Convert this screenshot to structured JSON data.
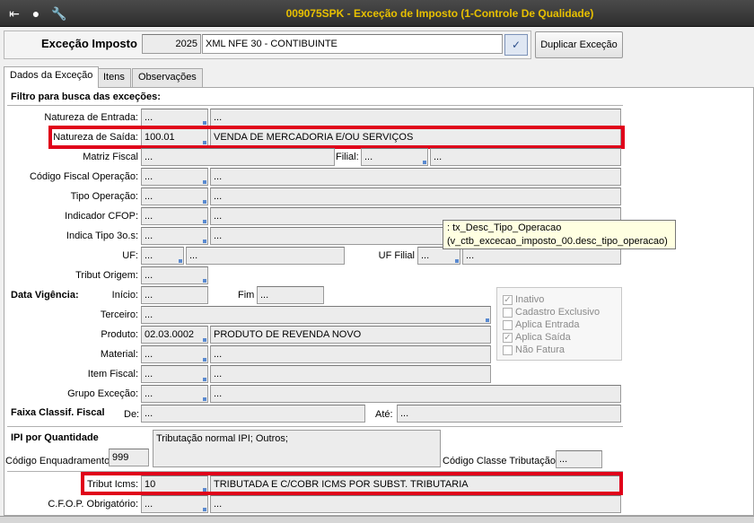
{
  "window": {
    "title": "009075SPK - Exceção de Imposto (1-Controle De Qualidade)",
    "icons": [
      "exit-icon",
      "traffic-light-icon",
      "wrench-icon"
    ]
  },
  "header": {
    "label": "Exceção Imposto",
    "code": "2025",
    "description": "XML NFE 30 - CONTIBUINTE",
    "duplicate_label": "Duplicar Exceção"
  },
  "tabs": [
    "Dados da Exceção",
    "Itens",
    "Observações"
  ],
  "filter_title": "Filtro para busca das exceções:",
  "fields": {
    "natureza_entrada": {
      "label": "Natureza de Entrada:",
      "code": "...",
      "desc": "..."
    },
    "natureza_saida": {
      "label": "Natureza de Saída:",
      "code": "100.01",
      "desc": "VENDA DE MERCADORIA E/OU SERVIÇOS"
    },
    "matriz_fiscal": {
      "label": "Matriz Fiscal",
      "value": "..."
    },
    "filial": {
      "label": "Filial:",
      "code": "...",
      "desc": "..."
    },
    "codigo_fiscal": {
      "label": "Código Fiscal Operação:",
      "code": "...",
      "desc": "..."
    },
    "tipo_operacao": {
      "label": "Tipo Operação:",
      "code": "...",
      "desc": "..."
    },
    "indicador_cfop": {
      "label": "Indicador CFOP:",
      "code": "...",
      "desc": "..."
    },
    "indica_tipo": {
      "label": "Indica Tipo 3o.s:",
      "code": "...",
      "desc": "..."
    },
    "uf": {
      "label": "UF:",
      "code": "...",
      "desc": "..."
    },
    "uf_filial": {
      "label": "UF Filial",
      "code": "...",
      "desc": "..."
    },
    "tribut_origem": {
      "label": "Tribut Origem:",
      "code": "..."
    },
    "data_vigencia": {
      "label": "Data Vigência:",
      "inicio_label": "Início:",
      "inicio": "...",
      "fim_label": "Fim",
      "fim": "..."
    },
    "terceiro": {
      "label": "Terceiro:",
      "value": "..."
    },
    "produto": {
      "label": "Produto:",
      "code": "02.03.0002",
      "desc": "PRODUTO DE REVENDA NOVO"
    },
    "material": {
      "label": "Material:",
      "code": "...",
      "desc": "..."
    },
    "item_fiscal": {
      "label": "Item Fiscal:",
      "code": "...",
      "desc": "..."
    },
    "grupo_excecao": {
      "label": "Grupo Exceção:",
      "code": "...",
      "desc": "..."
    },
    "faixa_classif": {
      "label": "Faixa Classif. Fiscal",
      "de_label": "De:",
      "de": "...",
      "ate_label": "Até:",
      "ate": "..."
    },
    "ipi": {
      "title": "IPI por Quantidade",
      "enq_label": "Código Enquadramento",
      "enq": "999",
      "text": "Tributação normal IPI; Outros;",
      "classe_label": "Código Classe Tributação",
      "classe": "..."
    },
    "tribut_icms": {
      "label": "Tribut Icms:",
      "code": "10",
      "desc": "TRIBUTADA E C/COBR ICMS POR SUBST. TRIBUTARIA"
    },
    "cfop_obrig": {
      "label": "C.F.O.P. Obrigatório:",
      "code": "...",
      "desc": "..."
    }
  },
  "checks": [
    {
      "label": "Inativo",
      "checked": true
    },
    {
      "label": "Cadastro Exclusivo",
      "checked": false
    },
    {
      "label": "Aplica Entrada",
      "checked": false
    },
    {
      "label": "Aplica Saída",
      "checked": true
    },
    {
      "label": "Não Fatura",
      "checked": false
    }
  ],
  "tooltip": {
    "line1": ": tx_Desc_Tipo_Operacao",
    "line2": "(v_ctb_excecao_imposto_00.desc_tipo_operacao)"
  },
  "colors": {
    "title": "#e8c000",
    "highlight": "#e0001a"
  }
}
